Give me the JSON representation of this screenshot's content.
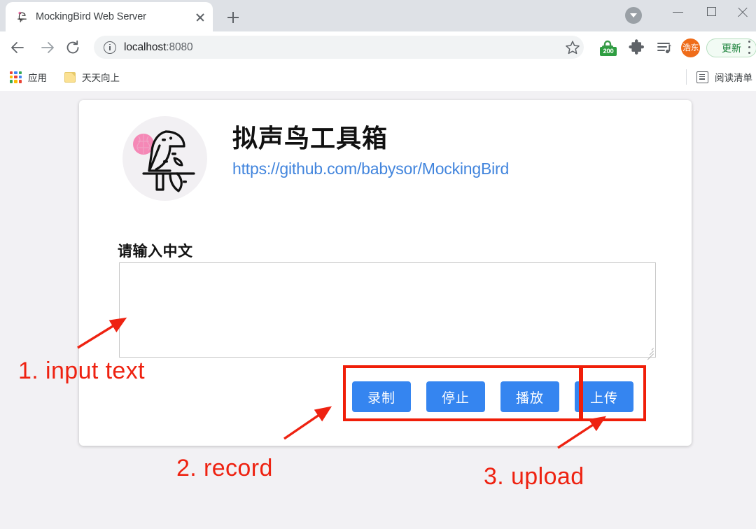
{
  "browser": {
    "tab": {
      "title": "MockingBird Web Server",
      "favicon": "mockingbird-favicon",
      "close_label": "×"
    },
    "new_tab_label": "+",
    "window_controls": {
      "minimize": "minimize-icon",
      "maximize": "maximize-icon",
      "close": "close-icon"
    },
    "tab_list_caret": "chevron-down-icon",
    "nav": {
      "back": "back-arrow-icon",
      "forward": "forward-arrow-icon",
      "reload": "reload-icon"
    },
    "omnibox": {
      "info_icon": "site-info-icon",
      "url_host": "localhost",
      "url_port": ":8080",
      "url_full": "localhost:8080"
    },
    "actions": {
      "bookmark": "star-icon",
      "lock_extension": "lock-extension-icon",
      "lock_badge": "200",
      "puzzle": "extensions-puzzle-icon",
      "media_list": "media-playlist-icon",
      "avatar_label": "浩东",
      "update_label": "更新",
      "menu": "kebab-menu-icon"
    },
    "bookmarks": {
      "apps_label": "应用",
      "apps_icon": "apps-grid-icon",
      "folder_label": "天天向上",
      "folder_icon": "folder-icon",
      "reading_list_label": "阅读清单",
      "reading_list_icon": "reading-list-icon"
    }
  },
  "page": {
    "logo_alt": "mockingbird-parrot-logo",
    "title": "拟声鸟工具箱",
    "link_text": "https://github.com/babysor/MockingBird",
    "form": {
      "label": "请输入中文",
      "textarea_value": "",
      "textarea_placeholder": ""
    },
    "buttons": {
      "record": "录制",
      "stop": "停止",
      "play": "播放",
      "upload": "上传"
    }
  },
  "annotations": {
    "step1": "1. input text",
    "step2": "2. record",
    "step3": "3. upload"
  },
  "colors": {
    "button_blue": "#3585f0",
    "link_blue": "#4285dd",
    "annotation_red": "#ee2211",
    "box_red": "#f01e09",
    "update_green": "#188038",
    "avatar_orange": "#ef6c1a",
    "badge_green": "#2e9e41"
  }
}
